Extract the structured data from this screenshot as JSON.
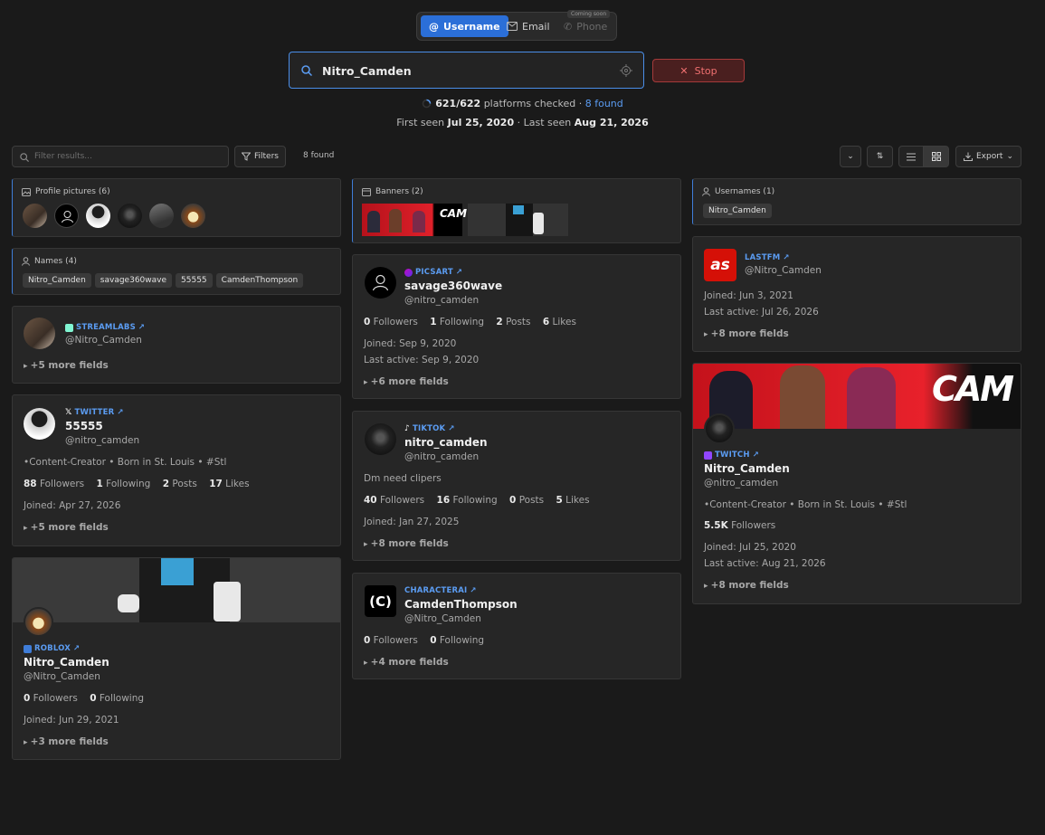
{
  "tabs": {
    "username": "Username",
    "email": "Email",
    "phone": "Phone",
    "coming_soon": "Coming soon"
  },
  "search": {
    "value": "Nitro_Camden",
    "stop_label": "Stop"
  },
  "progress": {
    "checked": "621/622",
    "text": "platforms checked",
    "found": "8 found"
  },
  "seen": {
    "first_label": "First seen",
    "first": "Jul 25, 2020",
    "last_label": "Last seen",
    "last": "Aug 21, 2026"
  },
  "toolbar": {
    "filter_placeholder": "Filter results...",
    "filters_label": "Filters",
    "found_count": "8 found",
    "export_label": "Export"
  },
  "aggregates": {
    "pictures_title": "Profile pictures (6)",
    "names_title": "Names (4)",
    "names": [
      "Nitro_Camden",
      "savage360wave",
      "55555",
      "CamdenThompson"
    ],
    "banners_title": "Banners (2)",
    "usernames_title": "Usernames (1)",
    "usernames": [
      "Nitro_Camden"
    ]
  },
  "cards": {
    "streamlabs": {
      "platform": "STREAMLABS",
      "handle": "@Nitro_Camden",
      "more": "+5 more fields"
    },
    "twitter": {
      "platform": "TWITTER",
      "name": "55555",
      "handle": "@nitro_camden",
      "bio": "•Content-Creator • Born in St. Louis • #Stl",
      "followers": "88",
      "following": "1",
      "posts": "2",
      "likes": "17",
      "joined": "Apr 27, 2026",
      "more": "+5 more fields"
    },
    "roblox": {
      "platform": "ROBLOX",
      "name": "Nitro_Camden",
      "handle": "@Nitro_Camden",
      "followers": "0",
      "following": "0",
      "joined": "Jun 29, 2021",
      "more": "+3 more fields"
    },
    "picsart": {
      "platform": "PICSART",
      "name": "savage360wave",
      "handle": "@nitro_camden",
      "followers": "0",
      "following": "1",
      "posts": "2",
      "likes": "6",
      "joined": "Sep 9, 2020",
      "last_active": "Sep 9, 2020",
      "more": "+6 more fields"
    },
    "tiktok": {
      "platform": "TIKTOK",
      "name": "nitro_camden",
      "handle": "@nitro_camden",
      "bio": "Dm need clipers",
      "followers": "40",
      "following": "16",
      "posts": "0",
      "likes": "5",
      "joined": "Jan 27, 2025",
      "more": "+8 more fields"
    },
    "characterai": {
      "platform": "CHARACTERAI",
      "name": "CamdenThompson",
      "handle": "@Nitro_Camden",
      "logo_text": "(C)",
      "followers": "0",
      "following": "0",
      "more": "+4 more fields"
    },
    "lastfm": {
      "platform": "LASTFM",
      "handle": "@Nitro_Camden",
      "joined": "Jun 3, 2021",
      "last_active": "Jul 26, 2026",
      "more": "+8 more fields"
    },
    "twitch": {
      "platform": "TWITCH",
      "name": "Nitro_Camden",
      "handle": "@nitro_camden",
      "bio": "•Content-Creator • Born in St. Louis • #Stl",
      "followers": "5.5K",
      "joined": "Jul 25, 2020",
      "last_active": "Aug 21, 2026",
      "more": "+8 more fields",
      "banner_text": "CAM"
    }
  },
  "labels": {
    "followers": "Followers",
    "following": "Following",
    "posts": "Posts",
    "likes": "Likes",
    "joined": "Joined:",
    "last_active": "Last active:"
  },
  "colors": {
    "accent": "#2b6fd8",
    "link": "#5b9cf2",
    "stop": "#f07070",
    "lastfm": "#d51007",
    "twitch": "#9146ff"
  }
}
